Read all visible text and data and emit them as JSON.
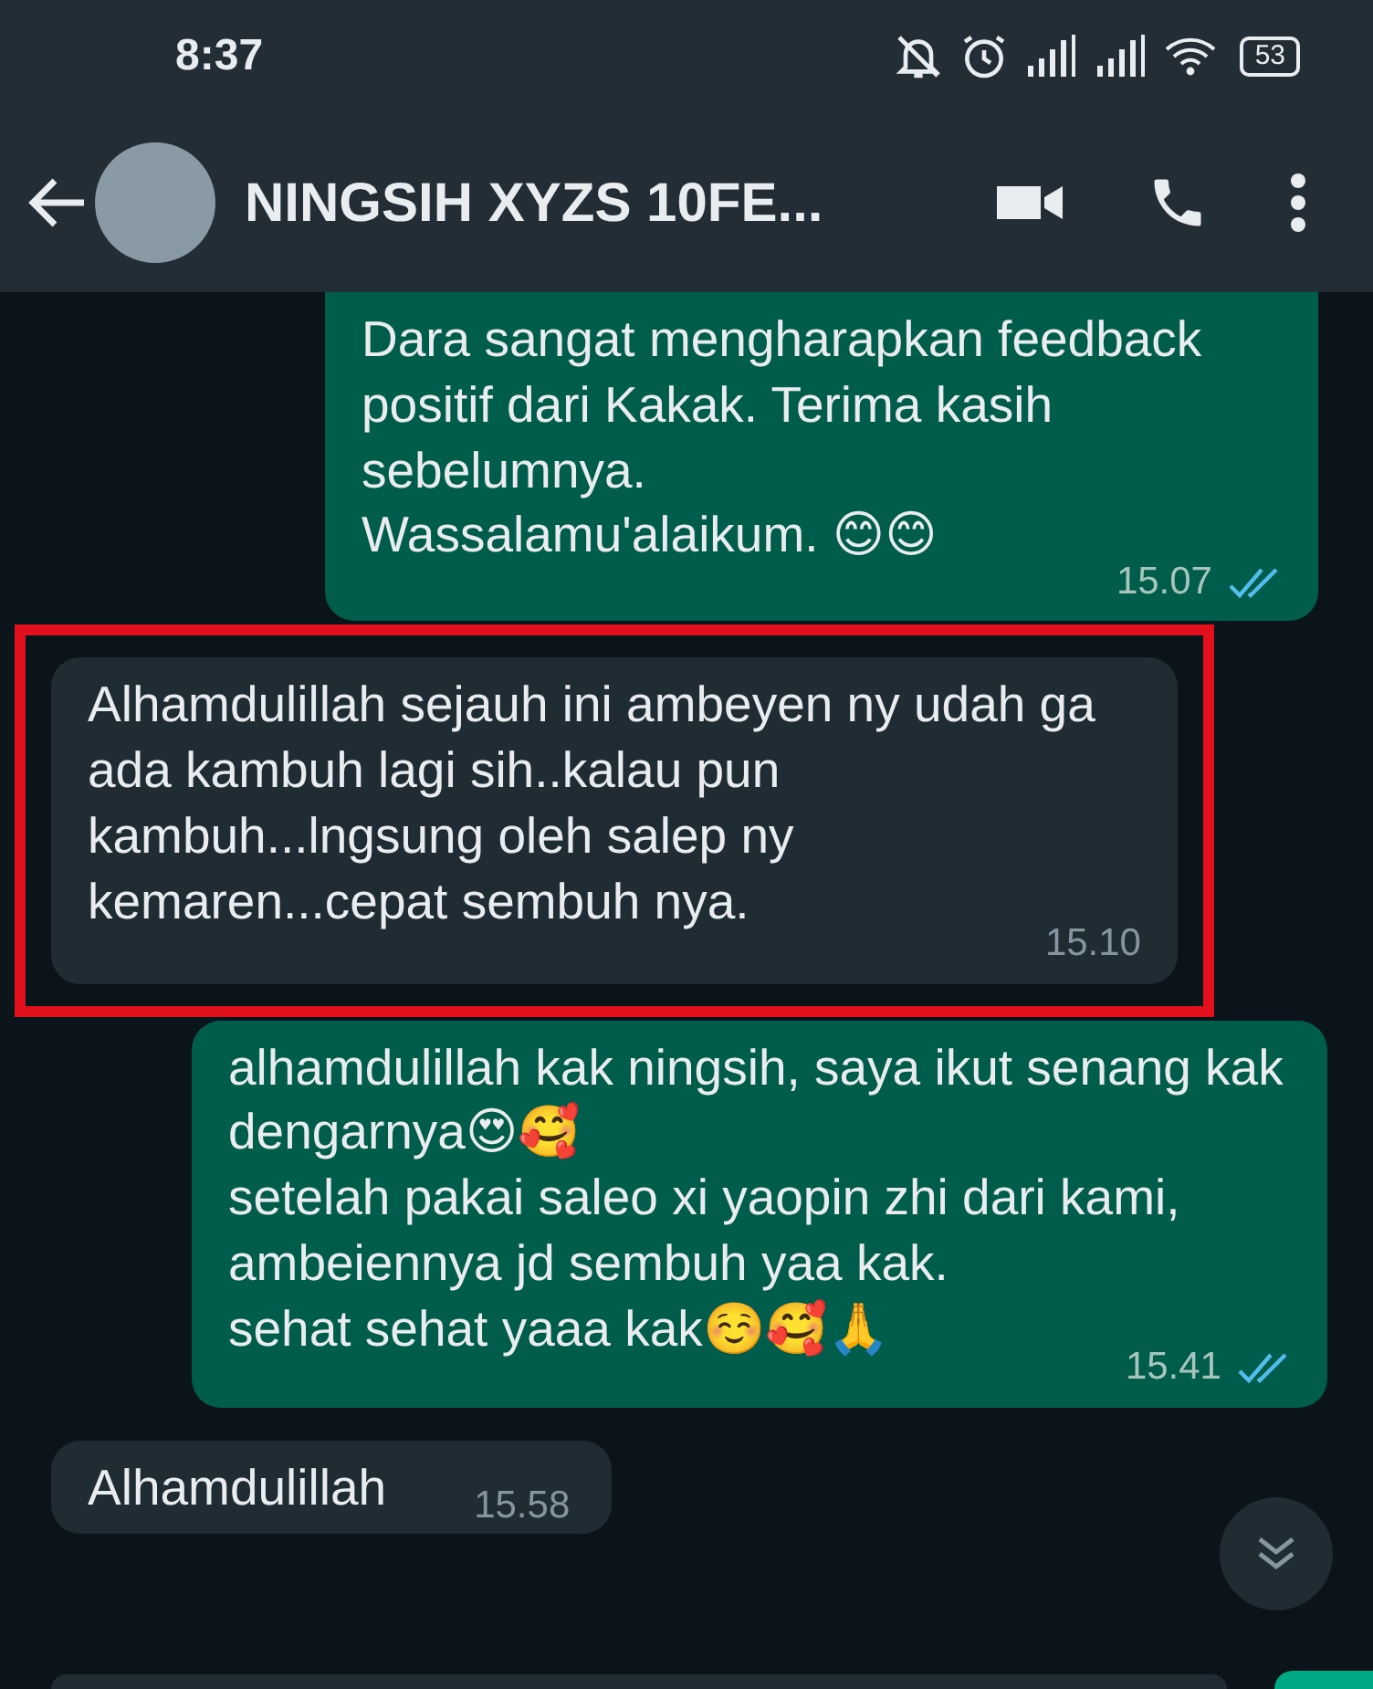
{
  "status_bar": {
    "time": "8:37",
    "battery": "53"
  },
  "header": {
    "title": "NINGSIH XYZS 10FE..."
  },
  "messages": [
    {
      "kind": "outgoing",
      "paragraphs": [
        "Dara sangat mengharapkan feedback positif dari Kakak. Terima kasih sebelumnya.",
        "Wassalamu'alaikum. 😊😊"
      ],
      "time": "15.07",
      "read": true,
      "highlighted": false
    },
    {
      "kind": "incoming",
      "paragraphs": [
        "Alhamdulillah sejauh ini ambeyen ny udah ga ada kambuh lagi sih..kalau pun kambuh...lngsung oleh salep ny kemaren...cepat sembuh nya."
      ],
      "time": "15.10",
      "read": false,
      "highlighted": true
    },
    {
      "kind": "outgoing",
      "paragraphs": [
        "alhamdulillah kak ningsih, saya ikut senang kak dengarnya😍🥰",
        "setelah pakai saleo xi yaopin zhi dari kami, ambeiennya jd sembuh yaa kak.",
        "sehat sehat yaaa kak☺️🥰🙏"
      ],
      "time": "15.41",
      "read": true,
      "highlighted": false
    },
    {
      "kind": "incoming",
      "paragraphs": [
        "Alhamdulillah"
      ],
      "time": "15.58",
      "read": false,
      "highlighted": false
    }
  ]
}
